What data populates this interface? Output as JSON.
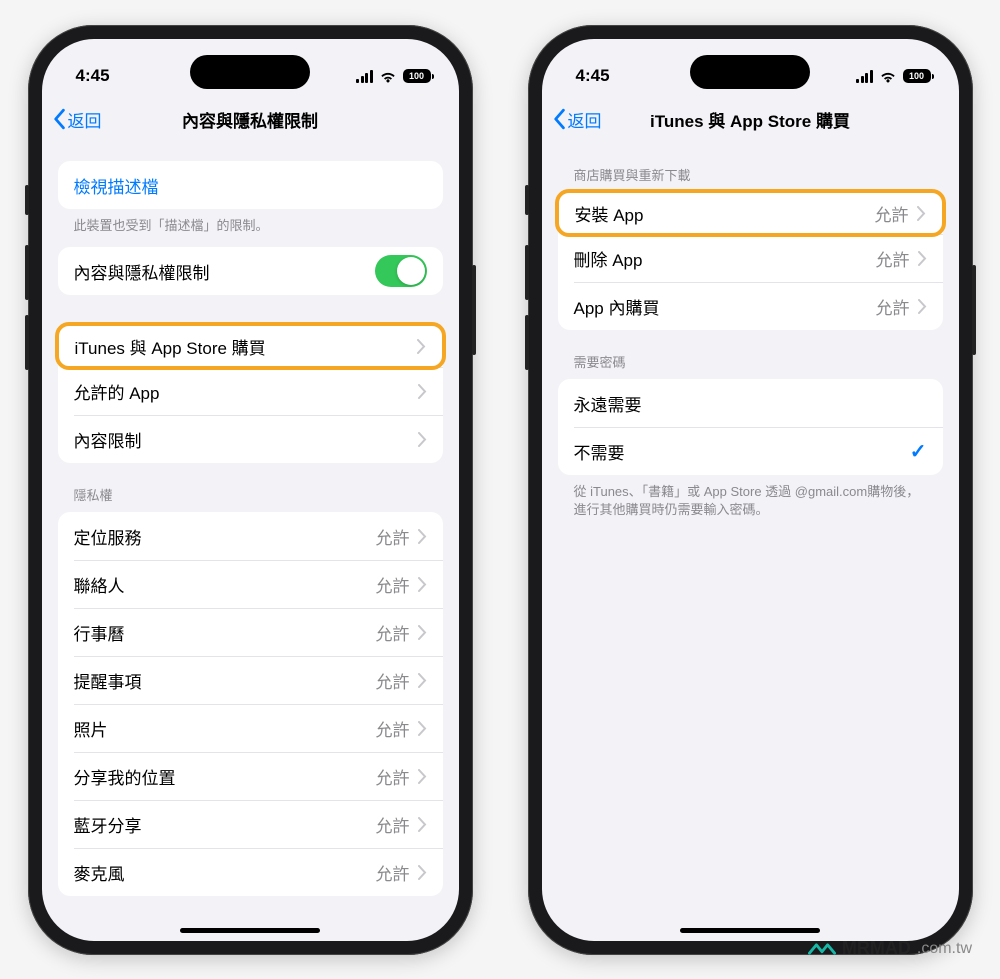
{
  "status": {
    "time": "4:45",
    "battery": "100"
  },
  "phone1": {
    "back": "返回",
    "title": "內容與隱私權限制",
    "profile_link": "檢視描述檔",
    "profile_footer": "此裝置也受到「描述檔」的限制。",
    "toggle_row": "內容與隱私權限制",
    "group2": {
      "itunes": "iTunes 與 App Store 購買",
      "allowed": "允許的 App",
      "restrict": "內容限制"
    },
    "privacy_header": "隱私權",
    "privacy_value": "允許",
    "privacy_rows": [
      "定位服務",
      "聯絡人",
      "行事曆",
      "提醒事項",
      "照片",
      "分享我的位置",
      "藍牙分享",
      "麥克風"
    ]
  },
  "phone2": {
    "back": "返回",
    "title": "iTunes 與 App Store 購買",
    "section1_header": "商店購買與重新下載",
    "section1_value": "允許",
    "section1_rows": [
      "安裝 App",
      "刪除 App",
      "App 內購買"
    ],
    "section2_header": "需要密碼",
    "section2_rows": [
      "永遠需要",
      "不需要"
    ],
    "footer": "從 iTunes、「書籍」或 App Store 透過              @gmail.com購物後，進行其他購買時仍需要輸入密碼。"
  },
  "watermark": {
    "brand": "MRMAD",
    "domain": ".com.tw"
  }
}
